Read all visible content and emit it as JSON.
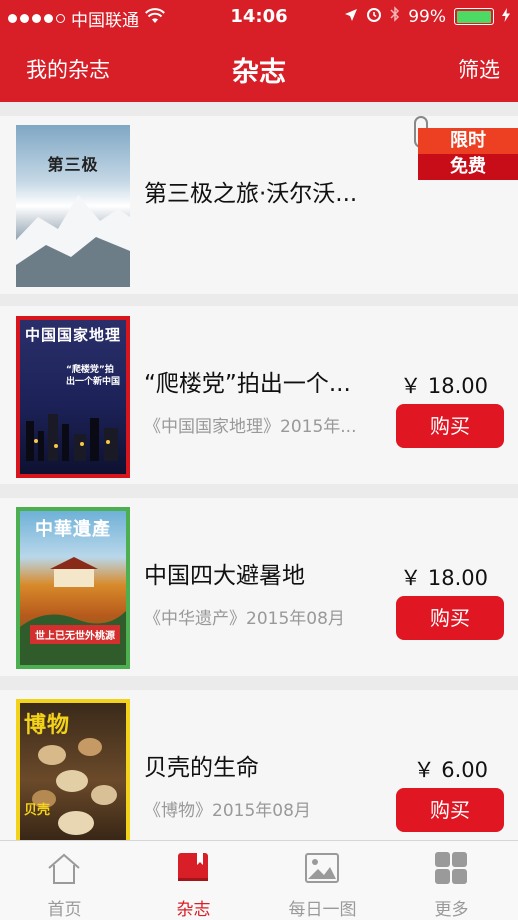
{
  "status": {
    "carrier": "中国联通",
    "time": "14:06",
    "battery": "99%",
    "battery_level": 0.99
  },
  "nav": {
    "left": "我的杂志",
    "title": "杂志",
    "right": "筛选"
  },
  "badge": {
    "line1": "限时",
    "line2": "免费"
  },
  "items": [
    {
      "title": "第三极之旅·沃尔沃...",
      "cover_title": "第三极"
    },
    {
      "title": "“爬楼党”拍出一个...",
      "subtitle": "《中国国家地理》2015年...",
      "price": "￥ 18.00",
      "buy": "购买",
      "cover_title": "中国国家地理",
      "cover_tag": "“爬楼党”拍出一个新中国"
    },
    {
      "title": "中国四大避暑地",
      "subtitle": "《中华遗产》2015年08月",
      "price": "￥ 18.00",
      "buy": "购买",
      "cover_title": "中華遺產",
      "cover_tag": "世上已无世外桃源"
    },
    {
      "title": "贝壳的生命",
      "subtitle": "《博物》2015年08月",
      "price": "￥ 6.00",
      "buy": "购买",
      "cover_title": "博物",
      "cover_tag": "贝壳"
    }
  ],
  "tabs": [
    {
      "label": "首页",
      "icon": "home-icon"
    },
    {
      "label": "杂志",
      "icon": "book-icon",
      "active": true
    },
    {
      "label": "每日一图",
      "icon": "picture-icon"
    },
    {
      "label": "更多",
      "icon": "grid-icon"
    }
  ],
  "colors": {
    "brand": "#d81e26",
    "buy": "#e01622",
    "tab_inactive": "#9a9a9a"
  }
}
